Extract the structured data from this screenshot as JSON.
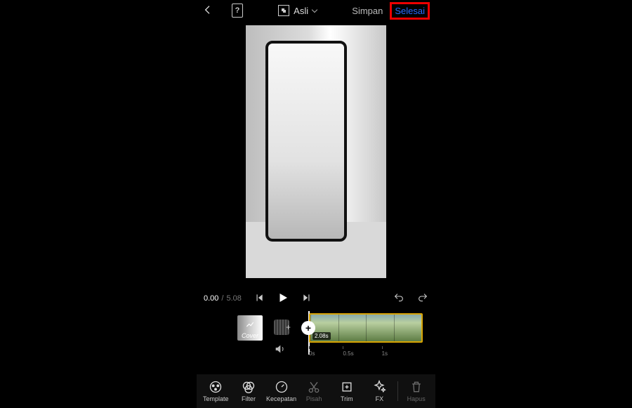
{
  "topbar": {
    "aspect_label": "Asli",
    "save_label": "Simpan",
    "done_label": "Selesai",
    "help_glyph": "?"
  },
  "transport": {
    "current_time": "0.00",
    "separator": "/",
    "duration": "5.08"
  },
  "timeline": {
    "cover_label": "Cover",
    "clip_duration_badge": "2.08s",
    "ruler": [
      "0s",
      "0.5s",
      "1s"
    ]
  },
  "tools": [
    {
      "id": "template",
      "label": "Template",
      "icon": "template",
      "interactable": true
    },
    {
      "id": "filter",
      "label": "Filter",
      "icon": "filter",
      "interactable": true
    },
    {
      "id": "kecepatan",
      "label": "Kecepatan",
      "icon": "speed",
      "interactable": true
    },
    {
      "id": "pisah",
      "label": "Pisah",
      "icon": "split",
      "interactable": false
    },
    {
      "id": "trim",
      "label": "Trim",
      "icon": "trim",
      "interactable": true
    },
    {
      "id": "fx",
      "label": "FX",
      "icon": "fx",
      "interactable": true
    },
    {
      "id": "hapus",
      "label": "Hapus",
      "icon": "trash",
      "interactable": false
    }
  ]
}
